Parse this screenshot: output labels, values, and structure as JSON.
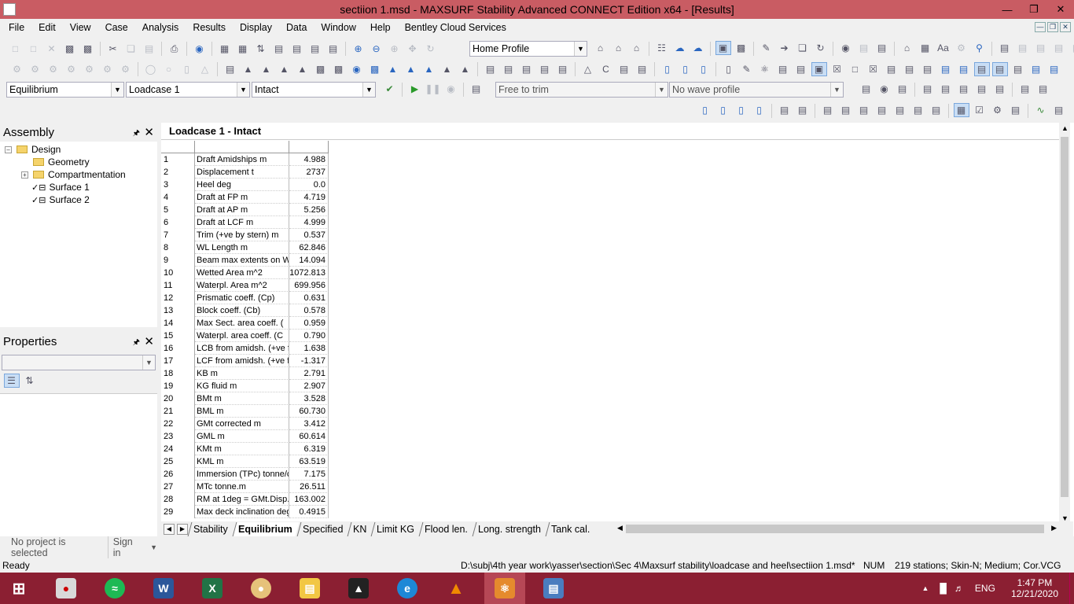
{
  "window": {
    "title": "sectiion 1.msd - MAXSURF Stability Advanced CONNECT Edition x64 - [Results]"
  },
  "menu": [
    "File",
    "Edit",
    "View",
    "Case",
    "Analysis",
    "Results",
    "Display",
    "Data",
    "Window",
    "Help",
    "Bentley Cloud Services"
  ],
  "toolbar": {
    "profile_combo": "Home Profile",
    "analysis_combo": "Equilibrium",
    "loadcase_combo": "Loadcase 1",
    "condition_combo": "Intact",
    "trim_combo": "Free to trim",
    "wave_combo": "No wave profile"
  },
  "assembly": {
    "title": "Assembly",
    "items": [
      {
        "label": "Design",
        "icon": "folder-icon"
      },
      {
        "label": "Geometry",
        "icon": "folder-icon"
      },
      {
        "label": "Compartmentation",
        "icon": "folder-icon"
      },
      {
        "label": "Surface 1",
        "icon": "check-icon"
      },
      {
        "label": "Surface 2",
        "icon": "check-icon"
      }
    ]
  },
  "properties": {
    "title": "Properties"
  },
  "results": {
    "title": "Loadcase 1 - Intact",
    "rows": [
      {
        "n": "1",
        "label": "Draft Amidships m",
        "value": "4.988"
      },
      {
        "n": "2",
        "label": "Displacement t",
        "value": "2737"
      },
      {
        "n": "3",
        "label": "Heel deg",
        "value": "0.0"
      },
      {
        "n": "4",
        "label": "Draft at FP m",
        "value": "4.719"
      },
      {
        "n": "5",
        "label": "Draft at AP m",
        "value": "5.256"
      },
      {
        "n": "6",
        "label": "Draft at LCF m",
        "value": "4.999"
      },
      {
        "n": "7",
        "label": "Trim (+ve by stern) m",
        "value": "0.537"
      },
      {
        "n": "8",
        "label": "WL Length m",
        "value": "62.846"
      },
      {
        "n": "9",
        "label": "Beam max extents on W",
        "value": "14.094"
      },
      {
        "n": "10",
        "label": "Wetted Area m^2",
        "value": "1072.813"
      },
      {
        "n": "11",
        "label": "Waterpl. Area m^2",
        "value": "699.956"
      },
      {
        "n": "12",
        "label": "Prismatic coeff. (Cp)",
        "value": "0.631"
      },
      {
        "n": "13",
        "label": "Block coeff. (Cb)",
        "value": "0.578"
      },
      {
        "n": "14",
        "label": "Max Sect. area coeff. (",
        "value": "0.959"
      },
      {
        "n": "15",
        "label": "Waterpl. area coeff. (C",
        "value": "0.790"
      },
      {
        "n": "16",
        "label": "LCB from amidsh. (+ve f",
        "value": "1.638"
      },
      {
        "n": "17",
        "label": "LCF from amidsh. (+ve f",
        "value": "-1.317"
      },
      {
        "n": "18",
        "label": "KB m",
        "value": "2.791"
      },
      {
        "n": "19",
        "label": "KG fluid m",
        "value": "2.907"
      },
      {
        "n": "20",
        "label": "BMt m",
        "value": "3.528"
      },
      {
        "n": "21",
        "label": "BML m",
        "value": "60.730"
      },
      {
        "n": "22",
        "label": "GMt corrected m",
        "value": "3.412"
      },
      {
        "n": "23",
        "label": "GML m",
        "value": "60.614"
      },
      {
        "n": "24",
        "label": "KMt m",
        "value": "6.319"
      },
      {
        "n": "25",
        "label": "KML m",
        "value": "63.519"
      },
      {
        "n": "26",
        "label": "Immersion (TPc) tonne/c",
        "value": "7.175"
      },
      {
        "n": "27",
        "label": "MTc tonne.m",
        "value": "26.511"
      },
      {
        "n": "28",
        "label": "RM at 1deg = GMt.Disp.",
        "value": "163.002"
      },
      {
        "n": "29",
        "label": "Max deck inclination deg",
        "value": "0.4915"
      }
    ]
  },
  "tabs": [
    "Stability",
    "Equilibrium",
    "Specified",
    "KN",
    "Limit KG",
    "Flood len.",
    "Long. strength",
    "Tank cal."
  ],
  "active_tab": "Equilibrium",
  "bottom": {
    "project": "No project is selected",
    "signin": "Sign in"
  },
  "status": {
    "ready": "Ready",
    "path": "D:\\subj\\4th year work\\yasser\\section\\Sec 4\\Maxsurf stability\\loadcase and heel\\sectiion 1.msd*",
    "num": "NUM",
    "info": "219 stations; Skin-N; Medium; Cor.VCG"
  },
  "taskbar": {
    "lang": "ENG",
    "time": "1:47 PM",
    "date": "12/21/2020"
  },
  "colors": {
    "titlebar": "#c95c63",
    "taskbar": "#8b1f32"
  }
}
